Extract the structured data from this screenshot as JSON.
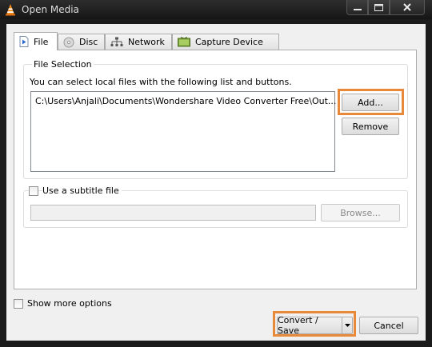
{
  "window": {
    "title": "Open Media",
    "controls": {
      "minimize": "—",
      "maximize": "□",
      "close": "✕"
    }
  },
  "tabs": [
    {
      "label": "File",
      "icon": "file-icon",
      "active": true
    },
    {
      "label": "Disc",
      "icon": "disc-icon",
      "active": false
    },
    {
      "label": "Network",
      "icon": "network-icon",
      "active": false
    },
    {
      "label": "Capture Device",
      "icon": "capture-device-icon",
      "active": false
    }
  ],
  "file_selection": {
    "title": "File Selection",
    "description": "You can select local files with the following list and buttons.",
    "files": [
      "C:\\Users\\Anjali\\Documents\\Wondershare Video Converter Free\\Out..."
    ],
    "add_label": "Add...",
    "remove_label": "Remove"
  },
  "subtitle": {
    "checkbox_label": "Use a subtitle file",
    "checked": false,
    "path_value": "",
    "browse_label": "Browse..."
  },
  "footer": {
    "show_more_label": "Show more options",
    "show_more_checked": false,
    "convert_label": "Convert / Save",
    "cancel_label": "Cancel"
  },
  "colors": {
    "highlight": "#e8893a",
    "titlebar": "#1b1b1b"
  }
}
